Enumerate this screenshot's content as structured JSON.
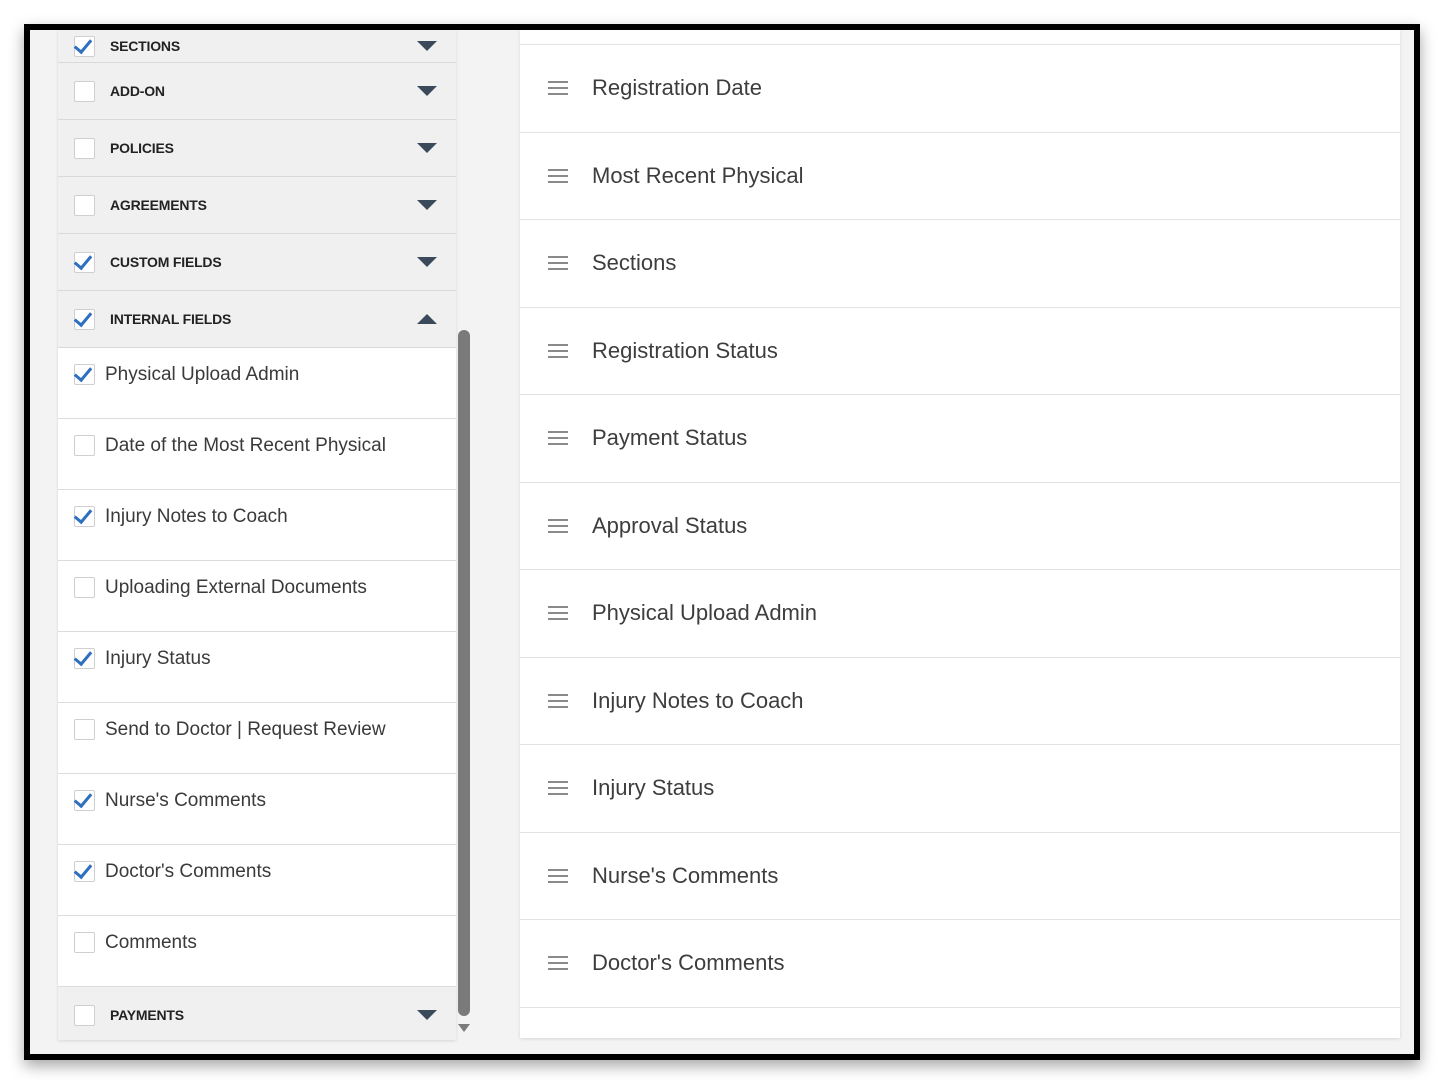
{
  "sections": [
    {
      "label": "SECTIONS",
      "checked": true,
      "expanded": false
    },
    {
      "label": "ADD-ON",
      "checked": false,
      "expanded": false
    },
    {
      "label": "POLICIES",
      "checked": false,
      "expanded": false
    },
    {
      "label": "AGREEMENTS",
      "checked": false,
      "expanded": false
    },
    {
      "label": "CUSTOM FIELDS",
      "checked": true,
      "expanded": false
    },
    {
      "label": "INTERNAL FIELDS",
      "checked": true,
      "expanded": true
    }
  ],
  "internal_fields": [
    {
      "label": "Physical Upload Admin",
      "checked": true
    },
    {
      "label": "Date of the Most Recent Physical",
      "checked": false
    },
    {
      "label": "Injury Notes to Coach",
      "checked": true
    },
    {
      "label": "Uploading External Documents",
      "checked": false
    },
    {
      "label": "Injury Status",
      "checked": true
    },
    {
      "label": "Send to Doctor | Request Review",
      "checked": false
    },
    {
      "label": "Nurse's Comments",
      "checked": true
    },
    {
      "label": "Doctor's Comments",
      "checked": true
    },
    {
      "label": "Comments",
      "checked": false
    }
  ],
  "payments_section": {
    "label": "PAYMENTS",
    "checked": false,
    "expanded": false
  },
  "selected_columns": [
    "Registration Date",
    "Most Recent Physical",
    "Sections",
    "Registration Status",
    "Payment Status",
    "Approval Status",
    "Physical Upload Admin",
    "Injury Notes to Coach",
    "Injury Status",
    "Nurse's Comments",
    "Doctor's Comments"
  ],
  "colors": {
    "check": "#2f6fbf",
    "caret": "#3a4a5a",
    "scrollbar": "#7a7a7a"
  },
  "icons": {
    "section_toggle": "chevron-down-icon",
    "drag": "drag-handle-icon"
  }
}
